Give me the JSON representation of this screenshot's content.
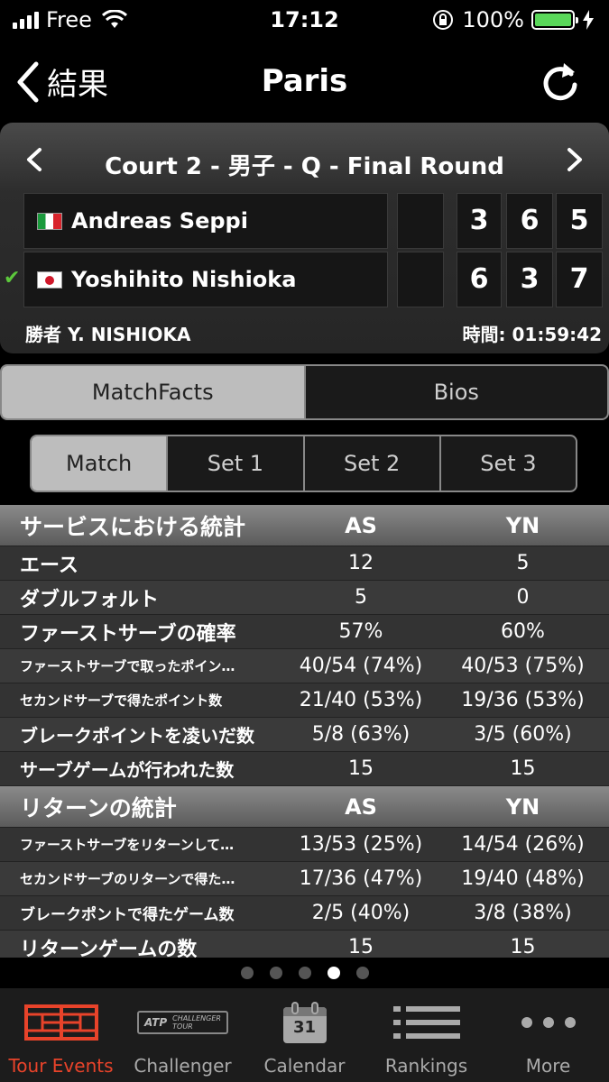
{
  "status_bar": {
    "carrier": "Free",
    "time": "17:12",
    "battery": "100%"
  },
  "nav": {
    "back_label": "結果",
    "title": "Paris"
  },
  "match": {
    "title": "Court 2 - 男子 - Q - Final Round",
    "players": [
      {
        "name": "Andreas Seppi",
        "flag": "Italy",
        "scores": [
          "3",
          "6",
          "5"
        ],
        "winner": false
      },
      {
        "name": "Yoshihito Nishioka",
        "flag": "Japan",
        "scores": [
          "6",
          "3",
          "7"
        ],
        "winner": true
      }
    ],
    "winner_text": "勝者 Y. NISHIOKA",
    "time_text": "時間: 01:59:42"
  },
  "segment1": {
    "items": [
      "MatchFacts",
      "Bios"
    ],
    "active": 0
  },
  "segment2": {
    "items": [
      "Match",
      "Set 1",
      "Set 2",
      "Set 3"
    ],
    "active": 0
  },
  "stats": {
    "service": {
      "title": "サービスにおける統計",
      "col_a": "AS",
      "col_b": "YN",
      "rows": [
        {
          "label": "エース",
          "a": "12",
          "b": "5"
        },
        {
          "label": "ダブルフォルト",
          "a": "5",
          "b": "0"
        },
        {
          "label": "ファーストサーブの確率",
          "a": "57%",
          "b": "60%"
        },
        {
          "label": "ファーストサーブで取ったポイン…",
          "a": "40/54 (74%)",
          "b": "40/53 (75%)"
        },
        {
          "label": "セカンドサーブで得たポイント数",
          "a": "21/40 (53%)",
          "b": "19/36 (53%)"
        },
        {
          "label": "ブレークポイントを凌いだ数",
          "a": "5/8 (63%)",
          "b": "3/5 (60%)"
        },
        {
          "label": "サーブゲームが行われた数",
          "a": "15",
          "b": "15"
        }
      ]
    },
    "return": {
      "title": "リターンの統計",
      "col_a": "AS",
      "col_b": "YN",
      "rows": [
        {
          "label": "ファーストサーブをリターンして…",
          "a": "13/53 (25%)",
          "b": "14/54 (26%)"
        },
        {
          "label": "セカンドサーブのリターンで得た…",
          "a": "17/36 (47%)",
          "b": "19/40 (48%)"
        },
        {
          "label": "ブレークポントで得たゲーム数",
          "a": "2/5 (40%)",
          "b": "3/8 (38%)"
        },
        {
          "label": "リターンゲームの数",
          "a": "15",
          "b": "15"
        }
      ]
    }
  },
  "pager": {
    "count": 5,
    "active": 3
  },
  "tabs": [
    {
      "label": "Tour Events",
      "icon": "court-icon",
      "active": true
    },
    {
      "label": "Challenger",
      "icon": "atp-challenger-logo",
      "active": false
    },
    {
      "label": "Calendar",
      "icon": "calendar-icon",
      "active": false,
      "calendar_day": "31"
    },
    {
      "label": "Rankings",
      "icon": "list-icon",
      "active": false
    },
    {
      "label": "More",
      "icon": "more-icon",
      "active": false
    }
  ],
  "challenger_logo": {
    "atp": "ATP",
    "line1": "CHALLENGER",
    "line2": "TOUR"
  },
  "colors": {
    "accent": "#e8432a",
    "checkmark": "#5cc83c",
    "battery": "#5ad85a"
  }
}
